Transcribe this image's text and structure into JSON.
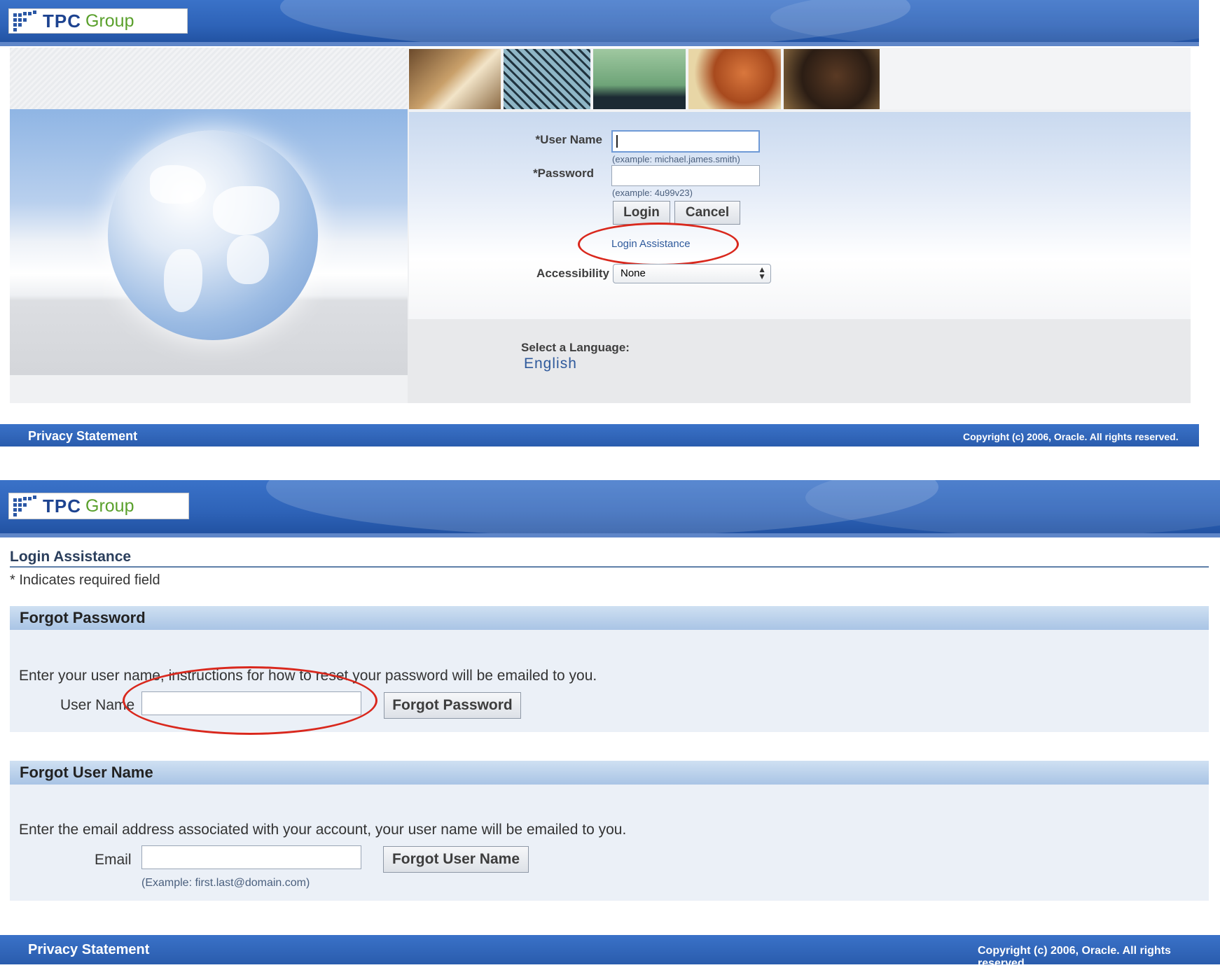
{
  "brand": {
    "logo_word": "TPC",
    "logo_suffix": "Group"
  },
  "login_page": {
    "username_label": "*User Name",
    "username_value": "",
    "username_hint": "(example: michael.james.smith)",
    "password_label": "*Password",
    "password_value": "",
    "password_hint": "(example: 4u99v23)",
    "login_button": "Login",
    "cancel_button": "Cancel",
    "login_assistance_link": "Login Assistance",
    "accessibility_label": "Accessibility",
    "accessibility_value": "None",
    "select_language_label": "Select a Language:",
    "language_link": "English"
  },
  "assist_page": {
    "page_title": "Login Assistance",
    "required_note": "* Indicates required field",
    "forgot_password": {
      "heading": "Forgot Password",
      "instruction": "Enter your user name, instructions for how to reset your password will be emailed to you.",
      "field_label": "User Name",
      "field_value": "",
      "button": "Forgot Password"
    },
    "forgot_username": {
      "heading": "Forgot User Name",
      "instruction": "Enter the email address associated with your account, your user name will be emailed to you.",
      "field_label": "Email",
      "field_value": "",
      "field_hint": "(Example: first.last@domain.com)",
      "button": "Forgot User Name"
    }
  },
  "footer": {
    "privacy_link": "Privacy Statement",
    "copyright": "Copyright (c) 2006, Oracle. All rights reserved."
  },
  "colors": {
    "banner_blue": "#2e63b8",
    "annotation_red": "#d9281d",
    "logo_green": "#5aa02c"
  }
}
